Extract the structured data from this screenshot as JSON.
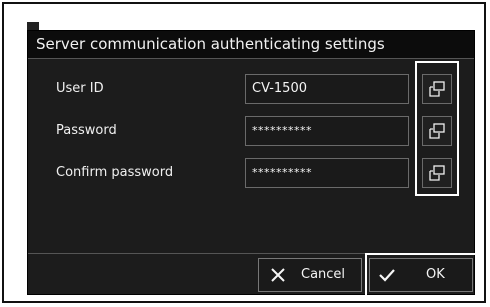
{
  "dialog": {
    "title": "Server communication authenticating settings"
  },
  "fields": [
    {
      "label": "User ID",
      "value": "CV-1500",
      "edit_icon": "edit-copy-icon"
    },
    {
      "label": "Password",
      "value": "**********",
      "edit_icon": "edit-copy-icon"
    },
    {
      "label": "Confirm password",
      "value": "**********",
      "edit_icon": "edit-copy-icon"
    }
  ],
  "footer": {
    "cancel_label": "Cancel",
    "cancel_icon": "close-x-icon",
    "ok_label": "OK",
    "ok_icon": "checkmark-icon"
  },
  "colors": {
    "dialog_bg": "#1c1c1c",
    "title_bg": "#0c0c0c",
    "text": "#f0f0f0",
    "highlight": "#ffffff"
  }
}
